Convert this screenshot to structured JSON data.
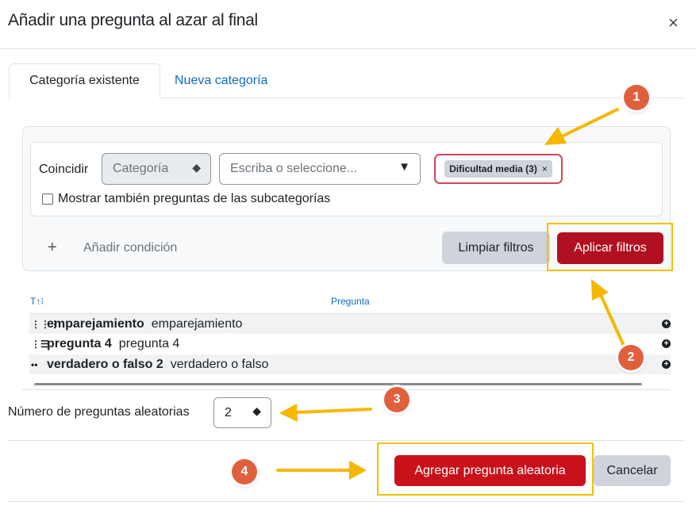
{
  "dialog": {
    "title": "Añadir una pregunta al azar al final",
    "close_label": "×"
  },
  "tabs": [
    {
      "label": "Categoría existente"
    },
    {
      "label": "Nueva categoría"
    }
  ],
  "filter": {
    "match_label": "Coincidir",
    "type_select": "Categoría",
    "search_placeholder": "Escriba o seleccione...",
    "tag_label": "Dificultad media (3)",
    "tag_remove": "×",
    "subcategories_label": "Mostrar también preguntas de las subcategorías",
    "add_condition_icon": "+",
    "add_condition_label": "Añadir condición",
    "clear_button": "Limpiar filtros",
    "apply_button": "Aplicar filtros"
  },
  "table": {
    "type_header": "T↑⁝",
    "question_header": "Pregunta",
    "rows": [
      {
        "icon": "⋮⋮⋮",
        "name": "emparejamiento",
        "text": "emparejamiento"
      },
      {
        "icon": "⋮☰",
        "name": "pregunta 4",
        "text": "pregunta 4"
      },
      {
        "icon": "••",
        "name": "verdadero o falso 2",
        "text": "verdadero o falso"
      }
    ]
  },
  "random": {
    "label": "Número de preguntas aleatorias",
    "value": "2"
  },
  "footer": {
    "add_button": "Agregar pregunta aleatoria",
    "cancel_button": "Cancelar"
  },
  "annotations": {
    "markers": [
      "1",
      "2",
      "3",
      "4"
    ],
    "highlight_color": "#f5c000",
    "arrow_color": "#f5b700",
    "marker_color": "#e0603e"
  },
  "icons": {
    "close": "close-icon",
    "select_arrow": "chevron-down-icon",
    "plus": "plus-icon"
  }
}
